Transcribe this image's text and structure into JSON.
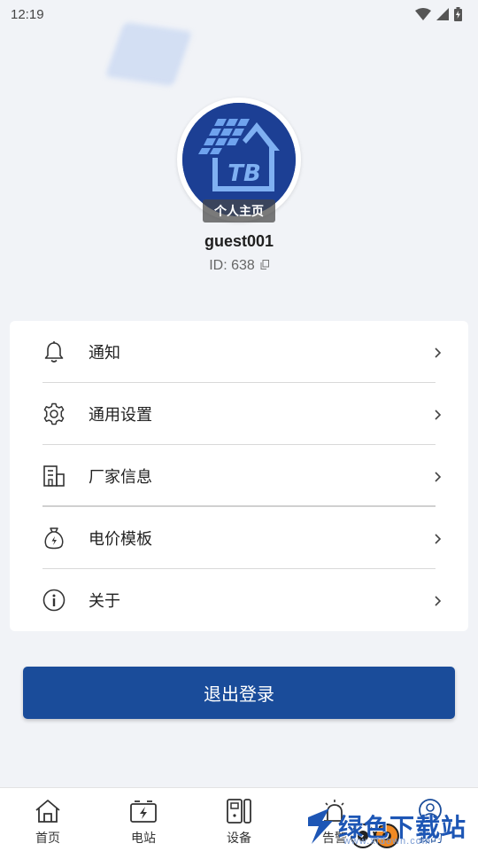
{
  "status_bar": {
    "time": "12:19",
    "icons": [
      "wifi-icon",
      "signal-icon",
      "battery-charging-icon"
    ]
  },
  "profile": {
    "avatar_logo_text": "TB",
    "home_badge": "个人主页",
    "username": "guest001",
    "user_id": "ID: 638"
  },
  "menu": {
    "items": [
      {
        "label": "通知",
        "icon": "bell-icon"
      },
      {
        "label": "通用设置",
        "icon": "gear-icon"
      },
      {
        "label": "厂家信息",
        "icon": "building-icon"
      },
      {
        "label": "电价模板",
        "icon": "money-bag-icon"
      },
      {
        "label": "关于",
        "icon": "info-icon"
      }
    ]
  },
  "logout": {
    "label": "退出登录"
  },
  "bottom_nav": {
    "items": [
      {
        "label": "首页",
        "icon": "home-icon"
      },
      {
        "label": "电站",
        "icon": "power-station-icon"
      },
      {
        "label": "设备",
        "icon": "device-icon"
      },
      {
        "label": "告警",
        "icon": "alarm-icon"
      },
      {
        "label": "我的",
        "icon": "profile-icon"
      }
    ],
    "active_index": 4
  },
  "watermark": {
    "text": "绿色下载站",
    "url": "www.xfdown.com"
  },
  "colors": {
    "primary": "#1a4c9a",
    "background": "#f1f3f7",
    "card": "#ffffff",
    "avatar_bg": "#1c3f94"
  }
}
